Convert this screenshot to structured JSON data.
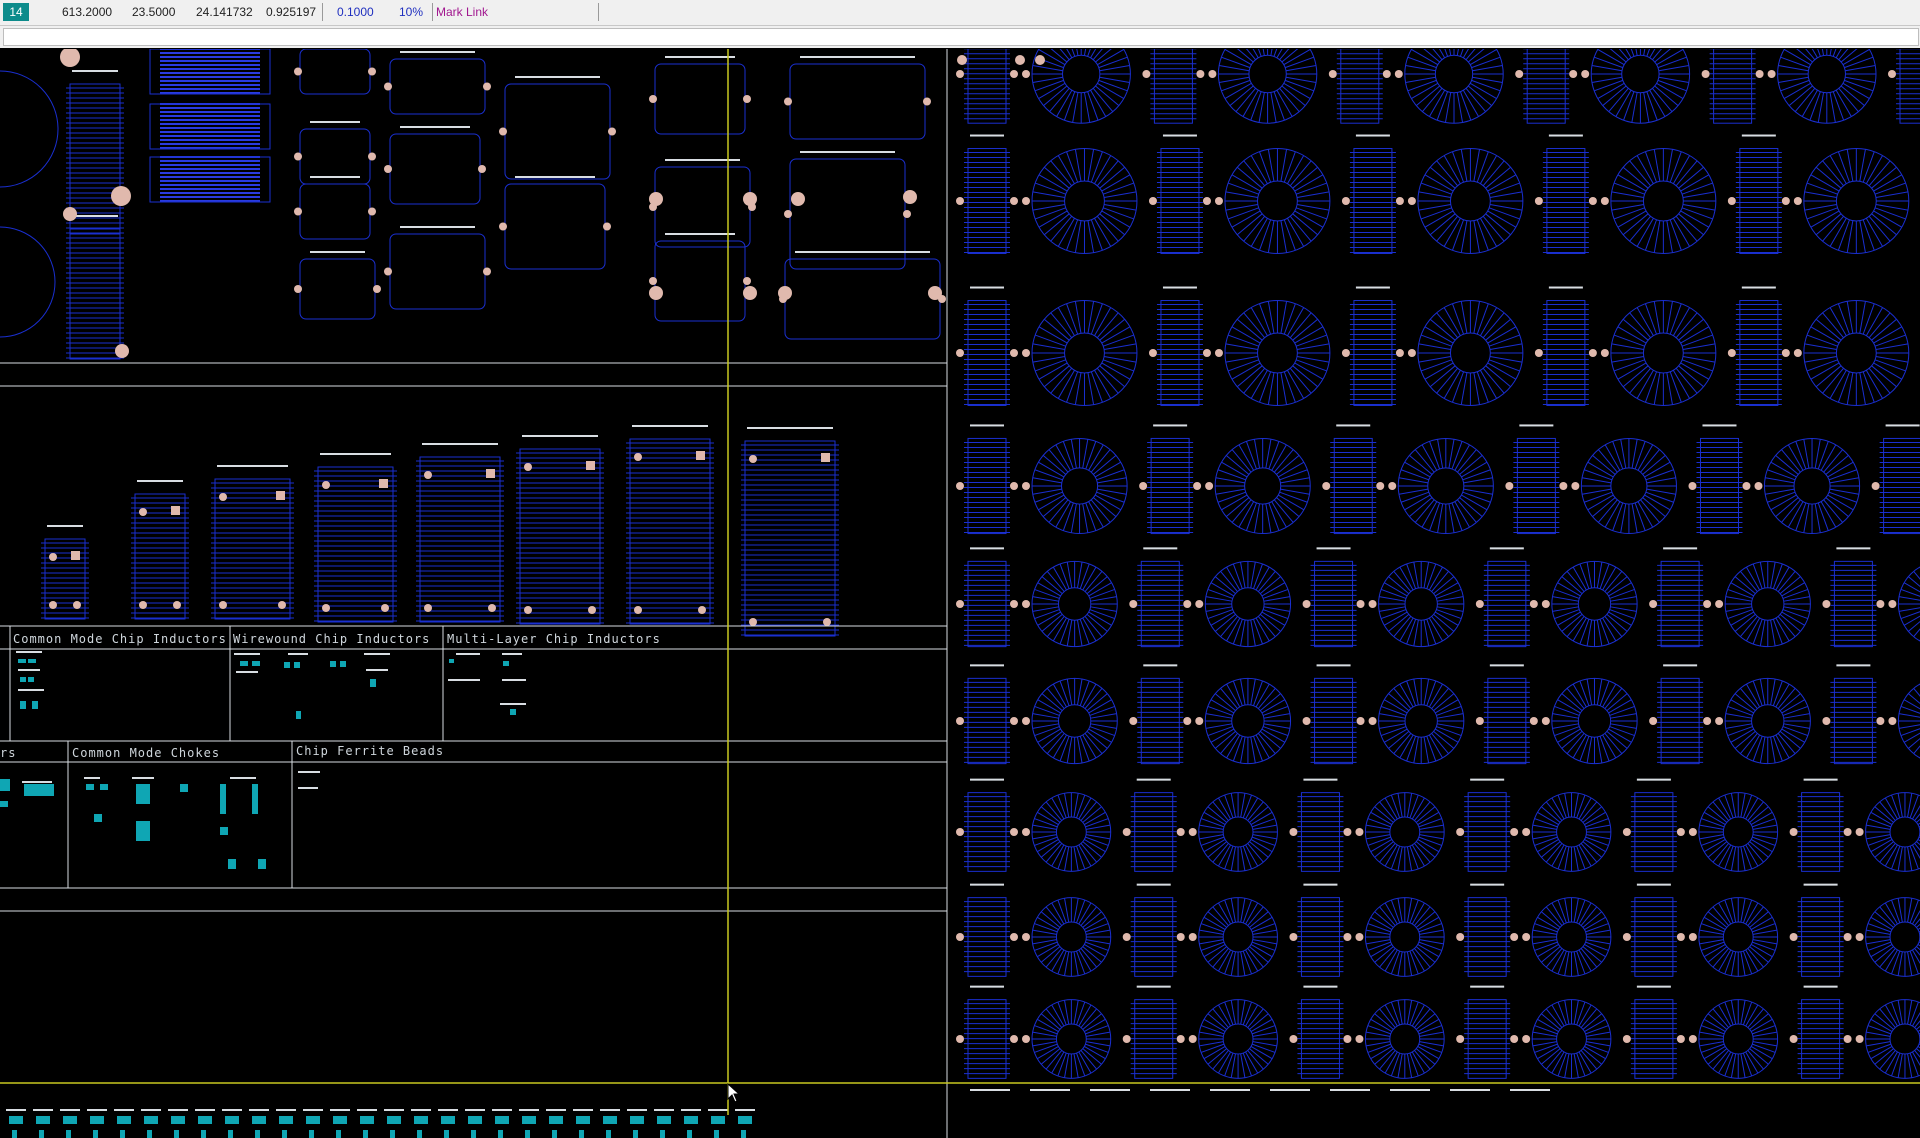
{
  "status": {
    "layer": "14",
    "x": "613.2000",
    "y": "23.5000",
    "distance": "24.141732",
    "angle": "0.925197",
    "grid": "0.1000",
    "zoom": "10%",
    "mode": "Mark Link"
  },
  "sections": {
    "common_mode_chip": "Common Mode Chip Inductors",
    "wirewound_chip": "Wirewound Chip Inductors",
    "multilayer_chip": "Multi-Layer Chip Inductors",
    "partial_left": "rs",
    "common_mode_chokes": "Common Mode Chokes",
    "chip_ferrite": "Chip Ferrite Beads"
  },
  "colors": {
    "background": "#000000",
    "outline": "#1a2fd0",
    "pad": "#e0b9ad",
    "smd_pad": "#0fa6b4",
    "divider": "#d8dde2",
    "crosshair": "#c8c820"
  },
  "icons": [
    "mouse-cursor-icon"
  ]
}
